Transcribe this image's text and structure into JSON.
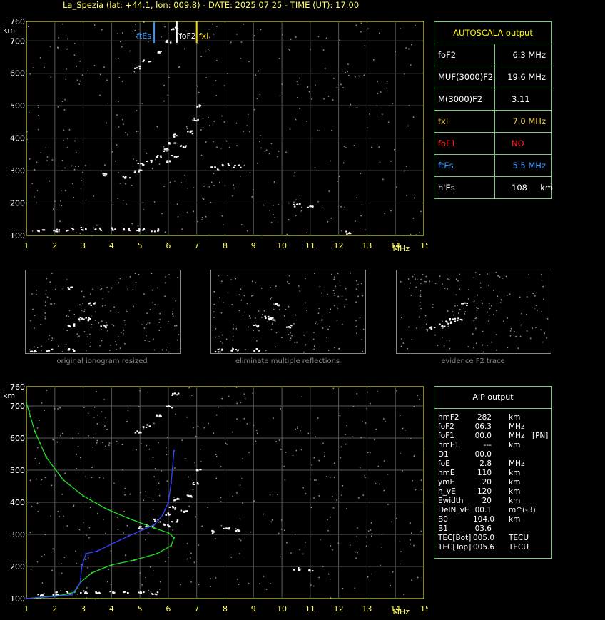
{
  "header": {
    "title": "La_Spezia (lat: +44.1, lon: 009.8) - DATE: 2025 07 25 - TIME (UT): 17:00"
  },
  "axes": {
    "y_unit": "km",
    "x_unit": "MHz",
    "y_ticks": [
      "100",
      "200",
      "300",
      "400",
      "500",
      "600",
      "700",
      "760"
    ],
    "x_ticks": [
      "1",
      "2",
      "3",
      "4",
      "5",
      "6",
      "7",
      "8",
      "9",
      "10",
      "11",
      "12",
      "13",
      "14",
      "15"
    ]
  },
  "markers": [
    {
      "label": "ftEs",
      "freq": 5.5,
      "color": "#3399ff"
    },
    {
      "label": "foF2",
      "freq": 6.3,
      "color": "#ffffff"
    },
    {
      "label": "fxI",
      "freq": 7.0,
      "color": "#ffdd00"
    }
  ],
  "autoscala": {
    "title": "AUTOSCALA output",
    "rows": [
      {
        "label": "foF2",
        "value": "6.3 MHz",
        "color": "#ffffff",
        "align": "right"
      },
      {
        "label": "MUF(3000)F2",
        "value": "19.6 MHz",
        "color": "#ffffff",
        "align": "right"
      },
      {
        "label": "M(3000)F2",
        "value": "3.11",
        "color": "#ffffff",
        "align": "center"
      },
      {
        "label": "fxI",
        "value": "7.0 MHz",
        "color": "#e8c850",
        "align": "right"
      },
      {
        "label": "foF1",
        "value": "NO",
        "color": "#ff2020",
        "align": "center"
      },
      {
        "label": "ftEs",
        "value": "5.5 MHz",
        "color": "#3d9bff",
        "align": "right"
      },
      {
        "label": "h'Es",
        "value": "108     km",
        "color": "#ffffff",
        "align": "center"
      }
    ]
  },
  "thumbnails": [
    {
      "caption": "original ionogram resized"
    },
    {
      "caption": "eliminate multiple reflections"
    },
    {
      "caption": "evidence F2 trace"
    }
  ],
  "aip": {
    "title": "AIP output",
    "rows": [
      {
        "name": "hmF2",
        "value": "282",
        "unit": "km",
        "extra": ""
      },
      {
        "name": "foF2",
        "value": "06.3",
        "unit": "MHz",
        "extra": ""
      },
      {
        "name": "foF1",
        "value": "00.0",
        "unit": "MHz",
        "extra": "[PN]"
      },
      {
        "name": "hmF1",
        "value": "---",
        "unit": "km",
        "extra": ""
      },
      {
        "name": "D1",
        "value": "00.0",
        "unit": "",
        "extra": ""
      },
      {
        "name": "foE",
        "value": "2.8",
        "unit": "MHz",
        "extra": ""
      },
      {
        "name": "hmE",
        "value": "110",
        "unit": "km",
        "extra": ""
      },
      {
        "name": "ymE",
        "value": "20",
        "unit": "km",
        "extra": ""
      },
      {
        "name": "h_vE",
        "value": "120",
        "unit": "km",
        "extra": ""
      },
      {
        "name": "Ewidth",
        "value": "20",
        "unit": "km",
        "extra": ""
      },
      {
        "name": "DelN_vE",
        "value": "00.1",
        "unit": "m^(-3)",
        "extra": ""
      },
      {
        "name": "B0",
        "value": "104.0",
        "unit": "km",
        "extra": ""
      },
      {
        "name": "B1",
        "value": "03.6",
        "unit": "",
        "extra": ""
      },
      {
        "name": "TEC[Bot]",
        "value": "005.0",
        "unit": "TECU",
        "extra": ""
      },
      {
        "name": "TEC[Top]",
        "value": "005.6",
        "unit": "TECU",
        "extra": ""
      }
    ]
  },
  "chart_data": [
    {
      "type": "scatter",
      "title": "",
      "xlabel": "MHz",
      "ylabel": "km",
      "xlim": [
        1,
        15
      ],
      "ylim": [
        100,
        760
      ],
      "grid": true,
      "series": [
        {
          "name": "",
          "color": "#ffffff",
          "points": [
            [
              1.5,
              115
            ],
            [
              2,
              118
            ],
            [
              2.5,
              120
            ],
            [
              3,
              122
            ],
            [
              3.5,
              122
            ],
            [
              4,
              121
            ],
            [
              4.5,
              120
            ],
            [
              5,
              119
            ],
            [
              5.5,
              118
            ],
            [
              5,
              322
            ],
            [
              5.3,
              330
            ],
            [
              5.6,
              345
            ],
            [
              5.9,
              365
            ],
            [
              6.1,
              385
            ],
            [
              6.25,
              410
            ],
            [
              5.9,
              330
            ],
            [
              6.2,
              345
            ],
            [
              6.5,
              375
            ],
            [
              6.75,
              420
            ],
            [
              6.9,
              460
            ],
            [
              7,
              500
            ],
            [
              4.9,
              620
            ],
            [
              5.2,
              640
            ],
            [
              5.6,
              670
            ],
            [
              6,
              700
            ],
            [
              6.2,
              740
            ],
            [
              3.8,
              290
            ],
            [
              4.5,
              280
            ],
            [
              4.9,
              300
            ],
            [
              7.6,
              310
            ],
            [
              8,
              320
            ],
            [
              8.4,
              315
            ],
            [
              10.5,
              195
            ],
            [
              11,
              190
            ],
            [
              12.3,
              110
            ]
          ]
        }
      ]
    },
    {
      "type": "scatter",
      "title": "",
      "xlabel": "",
      "ylabel": "",
      "xlim": [
        1,
        15
      ],
      "ylim": [
        100,
        760
      ],
      "series": [
        {
          "name": "",
          "points": [
            [
              1.5,
              115
            ],
            [
              3,
              120
            ],
            [
              5,
              119
            ],
            [
              5,
              322
            ],
            [
              6,
              385
            ],
            [
              6.5,
              375
            ],
            [
              7,
              500
            ],
            [
              5,
              630
            ],
            [
              8,
              315
            ]
          ]
        }
      ]
    },
    {
      "type": "scatter",
      "title": "",
      "xlabel": "",
      "ylabel": "",
      "xlim": [
        1,
        15
      ],
      "ylim": [
        100,
        760
      ],
      "series": [
        {
          "name": "",
          "points": [
            [
              1.5,
              115
            ],
            [
              3,
              120
            ],
            [
              5,
              119
            ],
            [
              5,
              322
            ],
            [
              6,
              385
            ],
            [
              6.5,
              375
            ],
            [
              7,
              500
            ],
            [
              8,
              315
            ]
          ]
        }
      ]
    },
    {
      "type": "scatter",
      "title": "",
      "xlabel": "",
      "ylabel": "",
      "xlim": [
        1,
        15
      ],
      "ylim": [
        100,
        760
      ],
      "series": [
        {
          "name": "",
          "points": [
            [
              4,
              300
            ],
            [
              5,
              322
            ],
            [
              5.6,
              345
            ],
            [
              6,
              365
            ],
            [
              6.5,
              375
            ],
            [
              7,
              500
            ]
          ]
        }
      ]
    },
    {
      "type": "line",
      "title": "",
      "xlabel": "MHz",
      "ylabel": "km",
      "xlim": [
        1,
        15
      ],
      "ylim": [
        100,
        760
      ],
      "grid": true,
      "series": [
        {
          "name": "",
          "color": "#ffffff",
          "points": [
            [
              1.5,
              115
            ],
            [
              2,
              118
            ],
            [
              2.5,
              120
            ],
            [
              3,
              122
            ],
            [
              3.5,
              122
            ],
            [
              4,
              121
            ],
            [
              4.5,
              120
            ],
            [
              5,
              119
            ],
            [
              5.5,
              118
            ],
            [
              5,
              322
            ],
            [
              5.3,
              330
            ],
            [
              5.6,
              345
            ],
            [
              5.9,
              365
            ],
            [
              6.1,
              385
            ],
            [
              6.25,
              410
            ],
            [
              5.9,
              330
            ],
            [
              6.2,
              345
            ],
            [
              6.5,
              375
            ],
            [
              6.75,
              420
            ],
            [
              6.9,
              460
            ],
            [
              7,
              500
            ],
            [
              4.9,
              620
            ],
            [
              5.2,
              640
            ],
            [
              5.6,
              670
            ],
            [
              6,
              700
            ],
            [
              6.2,
              740
            ],
            [
              7.6,
              310
            ],
            [
              8,
              320
            ],
            [
              8.4,
              315
            ],
            [
              10.5,
              195
            ],
            [
              11,
              190
            ]
          ]
        },
        {
          "name": "",
          "color": "#22dd22",
          "points": [
            [
              1,
              710
            ],
            [
              1.3,
              620
            ],
            [
              1.7,
              540
            ],
            [
              2.3,
              470
            ],
            [
              3,
              420
            ],
            [
              3.8,
              380
            ],
            [
              4.6,
              350
            ],
            [
              5.5,
              320
            ],
            [
              6,
              305
            ],
            [
              6.2,
              290
            ],
            [
              6.1,
              265
            ],
            [
              5.6,
              240
            ],
            [
              4.8,
              220
            ],
            [
              4,
              205
            ],
            [
              3.3,
              180
            ],
            [
              2.9,
              150
            ],
            [
              2.7,
              120
            ],
            [
              2.2,
              110
            ],
            [
              1.5,
              104
            ],
            [
              1,
              100
            ]
          ]
        },
        {
          "name": "",
          "color": "#3344ff",
          "points": [
            [
              1,
              100
            ],
            [
              2,
              107
            ],
            [
              2.6,
              112
            ],
            [
              2.9,
              150
            ],
            [
              2.95,
              200
            ],
            [
              3.1,
              240
            ],
            [
              3.5,
              248
            ],
            [
              4,
              270
            ],
            [
              4.6,
              295
            ],
            [
              5.2,
              318
            ],
            [
              5.5,
              330
            ],
            [
              5.8,
              360
            ],
            [
              6,
              400
            ],
            [
              6.1,
              460
            ],
            [
              6.2,
              560
            ]
          ]
        }
      ]
    }
  ]
}
